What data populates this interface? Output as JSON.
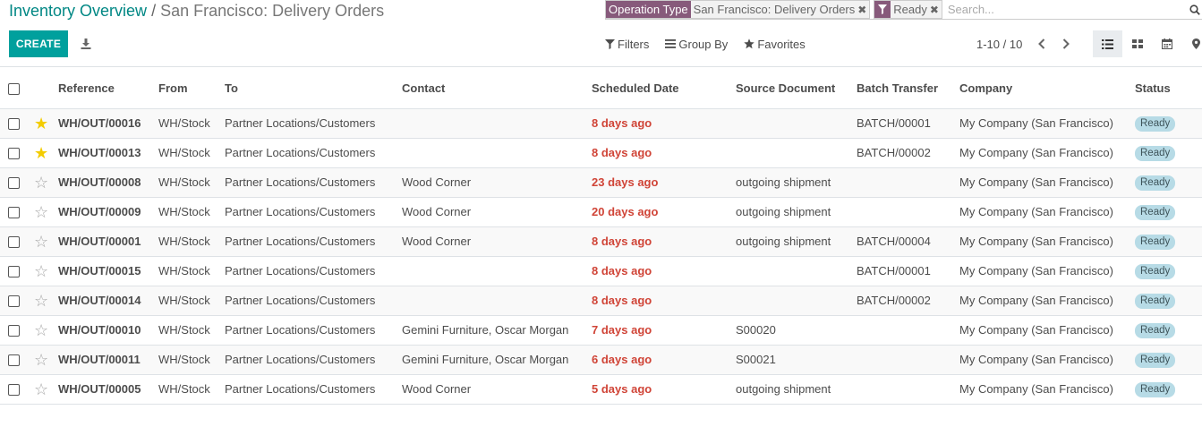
{
  "breadcrumb": {
    "parent": "Inventory Overview",
    "separator": "/",
    "current": "San Francisco: Delivery Orders"
  },
  "search": {
    "facets": [
      {
        "label": "Operation Type",
        "value": "San Francisco: Delivery Orders",
        "remove": "✖"
      },
      {
        "icon": "filter-icon",
        "value": "Ready",
        "remove": "✖"
      }
    ],
    "placeholder": "Search..."
  },
  "toolbar": {
    "create_label": "CREATE",
    "download_icon": "download-icon",
    "filters_label": "Filters",
    "groupby_label": "Group By",
    "favorites_label": "Favorites"
  },
  "pager": {
    "value": "1-10 / 10"
  },
  "views": [
    "list-view-icon",
    "kanban-view-icon",
    "calendar-view-icon",
    "map-view-icon"
  ],
  "colors": {
    "brand": "#875A7B",
    "primary": "#00A09D",
    "link": "#008784",
    "late_date": "#d04437",
    "badge_bg": "#b7dbe6",
    "star_on": "#f3cc00"
  },
  "table": {
    "headers": [
      "Reference",
      "From",
      "To",
      "Contact",
      "Scheduled Date",
      "Source Document",
      "Batch Transfer",
      "Company",
      "Status"
    ],
    "rows": [
      {
        "starred": true,
        "reference": "WH/OUT/00016",
        "from": "WH/Stock",
        "to": "Partner Locations/Customers",
        "contact": "",
        "scheduled": "8 days ago",
        "source": "",
        "batch": "BATCH/00001",
        "company": "My Company (San Francisco)",
        "status": "Ready"
      },
      {
        "starred": true,
        "reference": "WH/OUT/00013",
        "from": "WH/Stock",
        "to": "Partner Locations/Customers",
        "contact": "",
        "scheduled": "8 days ago",
        "source": "",
        "batch": "BATCH/00002",
        "company": "My Company (San Francisco)",
        "status": "Ready"
      },
      {
        "starred": false,
        "reference": "WH/OUT/00008",
        "from": "WH/Stock",
        "to": "Partner Locations/Customers",
        "contact": "Wood Corner",
        "scheduled": "23 days ago",
        "source": "outgoing shipment",
        "batch": "",
        "company": "My Company (San Francisco)",
        "status": "Ready"
      },
      {
        "starred": false,
        "reference": "WH/OUT/00009",
        "from": "WH/Stock",
        "to": "Partner Locations/Customers",
        "contact": "Wood Corner",
        "scheduled": "20 days ago",
        "source": "outgoing shipment",
        "batch": "",
        "company": "My Company (San Francisco)",
        "status": "Ready"
      },
      {
        "starred": false,
        "reference": "WH/OUT/00001",
        "from": "WH/Stock",
        "to": "Partner Locations/Customers",
        "contact": "Wood Corner",
        "scheduled": "8 days ago",
        "source": "outgoing shipment",
        "batch": "BATCH/00004",
        "company": "My Company (San Francisco)",
        "status": "Ready"
      },
      {
        "starred": false,
        "reference": "WH/OUT/00015",
        "from": "WH/Stock",
        "to": "Partner Locations/Customers",
        "contact": "",
        "scheduled": "8 days ago",
        "source": "",
        "batch": "BATCH/00001",
        "company": "My Company (San Francisco)",
        "status": "Ready"
      },
      {
        "starred": false,
        "reference": "WH/OUT/00014",
        "from": "WH/Stock",
        "to": "Partner Locations/Customers",
        "contact": "",
        "scheduled": "8 days ago",
        "source": "",
        "batch": "BATCH/00002",
        "company": "My Company (San Francisco)",
        "status": "Ready"
      },
      {
        "starred": false,
        "reference": "WH/OUT/00010",
        "from": "WH/Stock",
        "to": "Partner Locations/Customers",
        "contact": "Gemini Furniture, Oscar Morgan",
        "scheduled": "7 days ago",
        "source": "S00020",
        "batch": "",
        "company": "My Company (San Francisco)",
        "status": "Ready"
      },
      {
        "starred": false,
        "reference": "WH/OUT/00011",
        "from": "WH/Stock",
        "to": "Partner Locations/Customers",
        "contact": "Gemini Furniture, Oscar Morgan",
        "scheduled": "6 days ago",
        "source": "S00021",
        "batch": "",
        "company": "My Company (San Francisco)",
        "status": "Ready"
      },
      {
        "starred": false,
        "reference": "WH/OUT/00005",
        "from": "WH/Stock",
        "to": "Partner Locations/Customers",
        "contact": "Wood Corner",
        "scheduled": "5 days ago",
        "source": "outgoing shipment",
        "batch": "",
        "company": "My Company (San Francisco)",
        "status": "Ready"
      }
    ]
  }
}
